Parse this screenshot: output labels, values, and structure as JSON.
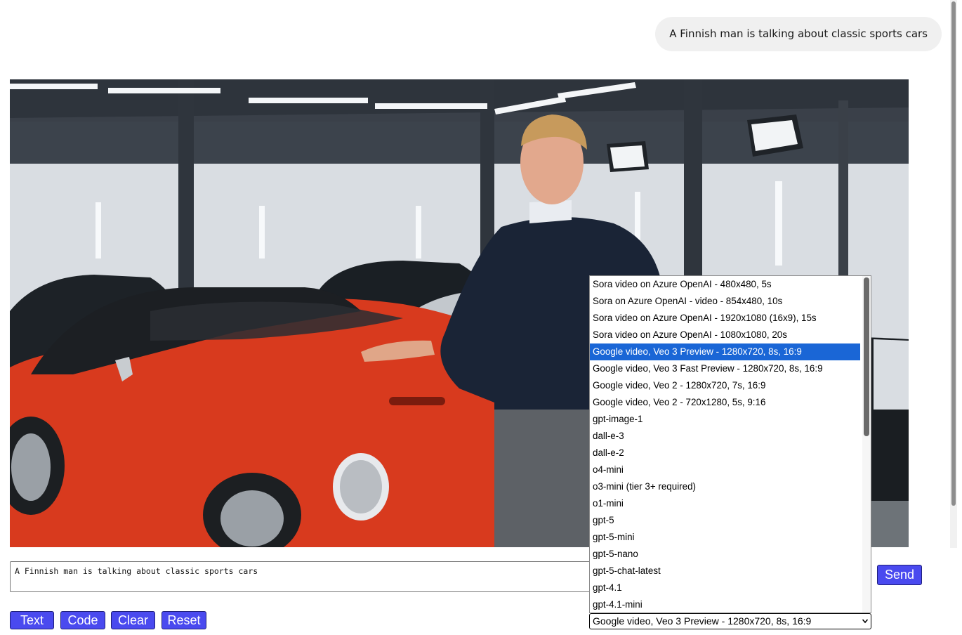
{
  "chat": {
    "user_message": "A Finnish man is talking about classic sports cars"
  },
  "video": {
    "alt": "A Finnish man is talking about classic sports cars"
  },
  "prompt": {
    "value": "A Finnish man is talking about classic sports cars"
  },
  "buttons": {
    "send": "Send",
    "text": "Text",
    "code": "Code",
    "clear": "Clear",
    "reset": "Reset"
  },
  "model_select": {
    "selected": "Google video, Veo 3 Preview - 1280x720, 8s, 16:9",
    "options": [
      "Sora video on Azure OpenAI - 480x480, 5s",
      "Sora on Azure OpenAI - video - 854x480, 10s",
      "Sora video on Azure OpenAI - 1920x1080 (16x9), 15s",
      "Sora video on Azure OpenAI - 1080x1080, 20s",
      "Google video, Veo 3 Preview - 1280x720, 8s, 16:9",
      "Google video, Veo 3 Fast Preview - 1280x720, 8s, 16:9",
      "Google video, Veo 2 - 1280x720, 7s, 16:9",
      "Google video, Veo 2 - 720x1280, 5s, 9:16",
      "gpt-image-1",
      "dall-e-3",
      "dall-e-2",
      "o4-mini",
      "o3-mini (tier 3+ required)",
      "o1-mini",
      "gpt-5",
      "gpt-5-mini",
      "gpt-5-nano",
      "gpt-5-chat-latest",
      "gpt-4.1",
      "gpt-4.1-mini"
    ],
    "highlighted_index": 4
  },
  "colors": {
    "button_bg": "#4a4aef",
    "highlight": "#1a66d6",
    "bubble_bg": "#f0f0f0"
  }
}
